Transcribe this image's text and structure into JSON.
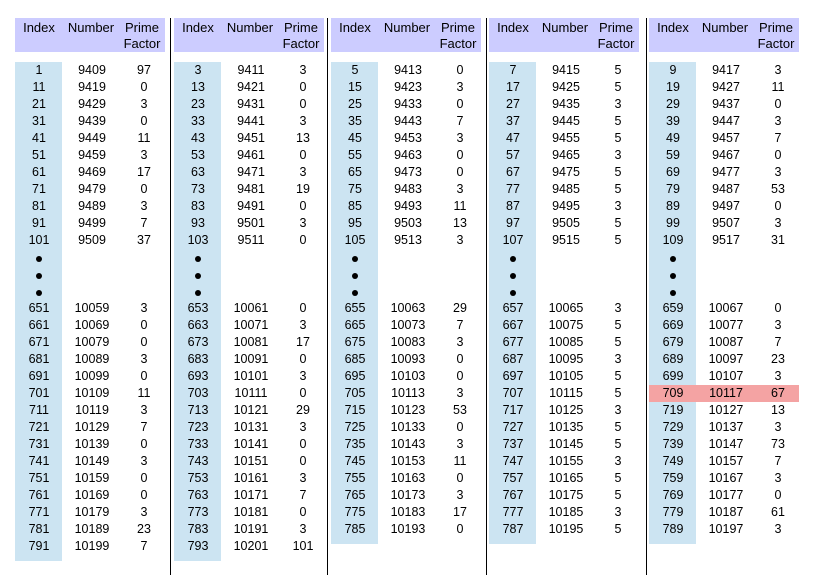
{
  "headers": {
    "index": "Index",
    "number": "Number",
    "prime": "Prime",
    "factor": "Factor"
  },
  "panels": [
    {
      "top": [
        [
          "1",
          "9409",
          "97"
        ],
        [
          "11",
          "9419",
          "0"
        ],
        [
          "21",
          "9429",
          "3"
        ],
        [
          "31",
          "9439",
          "0"
        ],
        [
          "41",
          "9449",
          "11"
        ],
        [
          "51",
          "9459",
          "3"
        ],
        [
          "61",
          "9469",
          "17"
        ],
        [
          "71",
          "9479",
          "0"
        ],
        [
          "81",
          "9489",
          "3"
        ],
        [
          "91",
          "9499",
          "7"
        ],
        [
          "101",
          "9509",
          "37"
        ]
      ],
      "bottom": [
        [
          "651",
          "10059",
          "3"
        ],
        [
          "661",
          "10069",
          "0"
        ],
        [
          "671",
          "10079",
          "0"
        ],
        [
          "681",
          "10089",
          "3"
        ],
        [
          "691",
          "10099",
          "0"
        ],
        [
          "701",
          "10109",
          "11"
        ],
        [
          "711",
          "10119",
          "3"
        ],
        [
          "721",
          "10129",
          "7"
        ],
        [
          "731",
          "10139",
          "0"
        ],
        [
          "741",
          "10149",
          "3"
        ],
        [
          "751",
          "10159",
          "0"
        ],
        [
          "761",
          "10169",
          "0"
        ],
        [
          "771",
          "10179",
          "3"
        ],
        [
          "781",
          "10189",
          "23"
        ],
        [
          "791",
          "10199",
          "7"
        ]
      ]
    },
    {
      "top": [
        [
          "3",
          "9411",
          "3"
        ],
        [
          "13",
          "9421",
          "0"
        ],
        [
          "23",
          "9431",
          "0"
        ],
        [
          "33",
          "9441",
          "3"
        ],
        [
          "43",
          "9451",
          "13"
        ],
        [
          "53",
          "9461",
          "0"
        ],
        [
          "63",
          "9471",
          "3"
        ],
        [
          "73",
          "9481",
          "19"
        ],
        [
          "83",
          "9491",
          "0"
        ],
        [
          "93",
          "9501",
          "3"
        ],
        [
          "103",
          "9511",
          "0"
        ]
      ],
      "bottom": [
        [
          "653",
          "10061",
          "0"
        ],
        [
          "663",
          "10071",
          "3"
        ],
        [
          "673",
          "10081",
          "17"
        ],
        [
          "683",
          "10091",
          "0"
        ],
        [
          "693",
          "10101",
          "3"
        ],
        [
          "703",
          "10111",
          "0"
        ],
        [
          "713",
          "10121",
          "29"
        ],
        [
          "723",
          "10131",
          "3"
        ],
        [
          "733",
          "10141",
          "0"
        ],
        [
          "743",
          "10151",
          "0"
        ],
        [
          "753",
          "10161",
          "3"
        ],
        [
          "763",
          "10171",
          "7"
        ],
        [
          "773",
          "10181",
          "0"
        ],
        [
          "783",
          "10191",
          "3"
        ],
        [
          "793",
          "10201",
          "101"
        ]
      ]
    },
    {
      "top": [
        [
          "5",
          "9413",
          "0"
        ],
        [
          "15",
          "9423",
          "3"
        ],
        [
          "25",
          "9433",
          "0"
        ],
        [
          "35",
          "9443",
          "7"
        ],
        [
          "45",
          "9453",
          "3"
        ],
        [
          "55",
          "9463",
          "0"
        ],
        [
          "65",
          "9473",
          "0"
        ],
        [
          "75",
          "9483",
          "3"
        ],
        [
          "85",
          "9493",
          "11"
        ],
        [
          "95",
          "9503",
          "13"
        ],
        [
          "105",
          "9513",
          "3"
        ]
      ],
      "bottom": [
        [
          "655",
          "10063",
          "29"
        ],
        [
          "665",
          "10073",
          "7"
        ],
        [
          "675",
          "10083",
          "3"
        ],
        [
          "685",
          "10093",
          "0"
        ],
        [
          "695",
          "10103",
          "0"
        ],
        [
          "705",
          "10113",
          "3"
        ],
        [
          "715",
          "10123",
          "53"
        ],
        [
          "725",
          "10133",
          "0"
        ],
        [
          "735",
          "10143",
          "3"
        ],
        [
          "745",
          "10153",
          "11"
        ],
        [
          "755",
          "10163",
          "0"
        ],
        [
          "765",
          "10173",
          "3"
        ],
        [
          "775",
          "10183",
          "17"
        ],
        [
          "785",
          "10193",
          "0"
        ]
      ]
    },
    {
      "top": [
        [
          "7",
          "9415",
          "5"
        ],
        [
          "17",
          "9425",
          "5"
        ],
        [
          "27",
          "9435",
          "3"
        ],
        [
          "37",
          "9445",
          "5"
        ],
        [
          "47",
          "9455",
          "5"
        ],
        [
          "57",
          "9465",
          "3"
        ],
        [
          "67",
          "9475",
          "5"
        ],
        [
          "77",
          "9485",
          "5"
        ],
        [
          "87",
          "9495",
          "3"
        ],
        [
          "97",
          "9505",
          "5"
        ],
        [
          "107",
          "9515",
          "5"
        ]
      ],
      "bottom": [
        [
          "657",
          "10065",
          "3"
        ],
        [
          "667",
          "10075",
          "5"
        ],
        [
          "677",
          "10085",
          "5"
        ],
        [
          "687",
          "10095",
          "3"
        ],
        [
          "697",
          "10105",
          "5"
        ],
        [
          "707",
          "10115",
          "5"
        ],
        [
          "717",
          "10125",
          "3"
        ],
        [
          "727",
          "10135",
          "5"
        ],
        [
          "737",
          "10145",
          "5"
        ],
        [
          "747",
          "10155",
          "3"
        ],
        [
          "757",
          "10165",
          "5"
        ],
        [
          "767",
          "10175",
          "5"
        ],
        [
          "777",
          "10185",
          "3"
        ],
        [
          "787",
          "10195",
          "5"
        ]
      ]
    },
    {
      "top": [
        [
          "9",
          "9417",
          "3"
        ],
        [
          "19",
          "9427",
          "11"
        ],
        [
          "29",
          "9437",
          "0"
        ],
        [
          "39",
          "9447",
          "3"
        ],
        [
          "49",
          "9457",
          "7"
        ],
        [
          "59",
          "9467",
          "0"
        ],
        [
          "69",
          "9477",
          "3"
        ],
        [
          "79",
          "9487",
          "53"
        ],
        [
          "89",
          "9497",
          "0"
        ],
        [
          "99",
          "9507",
          "3"
        ],
        [
          "109",
          "9517",
          "31"
        ]
      ],
      "bottom": [
        [
          "659",
          "10067",
          "0"
        ],
        [
          "669",
          "10077",
          "3"
        ],
        [
          "679",
          "10087",
          "7"
        ],
        [
          "689",
          "10097",
          "23"
        ],
        [
          "699",
          "10107",
          "3"
        ],
        [
          "709",
          "10117",
          "67"
        ],
        [
          "719",
          "10127",
          "13"
        ],
        [
          "729",
          "10137",
          "3"
        ],
        [
          "739",
          "10147",
          "73"
        ],
        [
          "749",
          "10157",
          "7"
        ],
        [
          "759",
          "10167",
          "3"
        ],
        [
          "769",
          "10177",
          "0"
        ],
        [
          "779",
          "10187",
          "61"
        ],
        [
          "789",
          "10197",
          "3"
        ]
      ]
    }
  ],
  "highlight": {
    "panel": 4,
    "index": "709"
  },
  "colors": {
    "header": "#ccccff",
    "index_column": "#cce4f2",
    "highlight_row": "#f4a3a3"
  }
}
